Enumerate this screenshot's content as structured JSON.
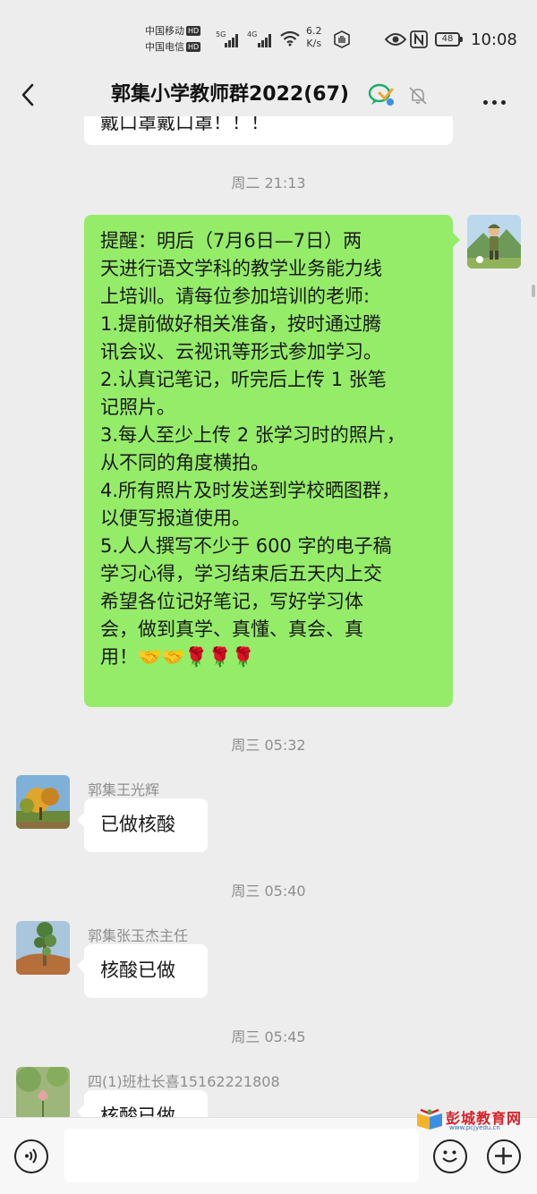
{
  "status_bar": {
    "carrier_1": "中国移动",
    "carrier_2": "中国电信",
    "hd_label": "HD",
    "net_5g": "5G",
    "net_4g": "4G",
    "speed_value": "6.2",
    "speed_unit": "K/s",
    "battery": "48",
    "time": "10:08"
  },
  "header": {
    "title": "郭集小学教师群2022(67)"
  },
  "messages": {
    "top_partial": "戴口罩戴口罩！！！",
    "ts1": "周二 21:13",
    "reminder": {
      "line1": "提醒：明后（7月6日—7日）两",
      "line2": "天进行语文学科的教学业务能力线",
      "line3": "上培训。请每位参加培训的老师:",
      "line4": "1.提前做好相关准备，按时通过腾",
      "line5": "讯会议、云视讯等形式参加学习。",
      "line6": "2.认真记笔记，听完后上传 1 张笔",
      "line7": "记照片。",
      "line8": "3.每人至少上传 2 张学习时的照片，",
      "line9": "从不同的角度横拍。",
      "line10": "4.所有照片及时发送到学校晒图群，",
      "line11": "以便写报道使用。",
      "line12": "5.人人撰写不少于 600 字的电子稿",
      "line13": "学习心得，学习结束后五天内上交",
      "line14": "希望各位记好笔记，写好学习体",
      "line15": "会，做到真学、真懂、真会、真",
      "line16": "用！🤝🤝🌹🌹🌹"
    },
    "ts2": "周三 05:32",
    "sender1": "郭集王光辉",
    "msg1": "已做核酸",
    "ts3": "周三 05:40",
    "sender2": "郭集张玉杰主任",
    "msg2": "核酸已做",
    "ts4": "周三 05:45",
    "sender3": "四(1)班杜长喜15162221808",
    "msg3": "核酸已做"
  },
  "watermark": {
    "text": "彭城教育网",
    "url": "www.pcjyedu.cn"
  },
  "colors": {
    "background": "#ededed",
    "own_bubble": "#95ec69",
    "other_bubble": "#ffffff",
    "timestamp": "#8e8e8e"
  }
}
